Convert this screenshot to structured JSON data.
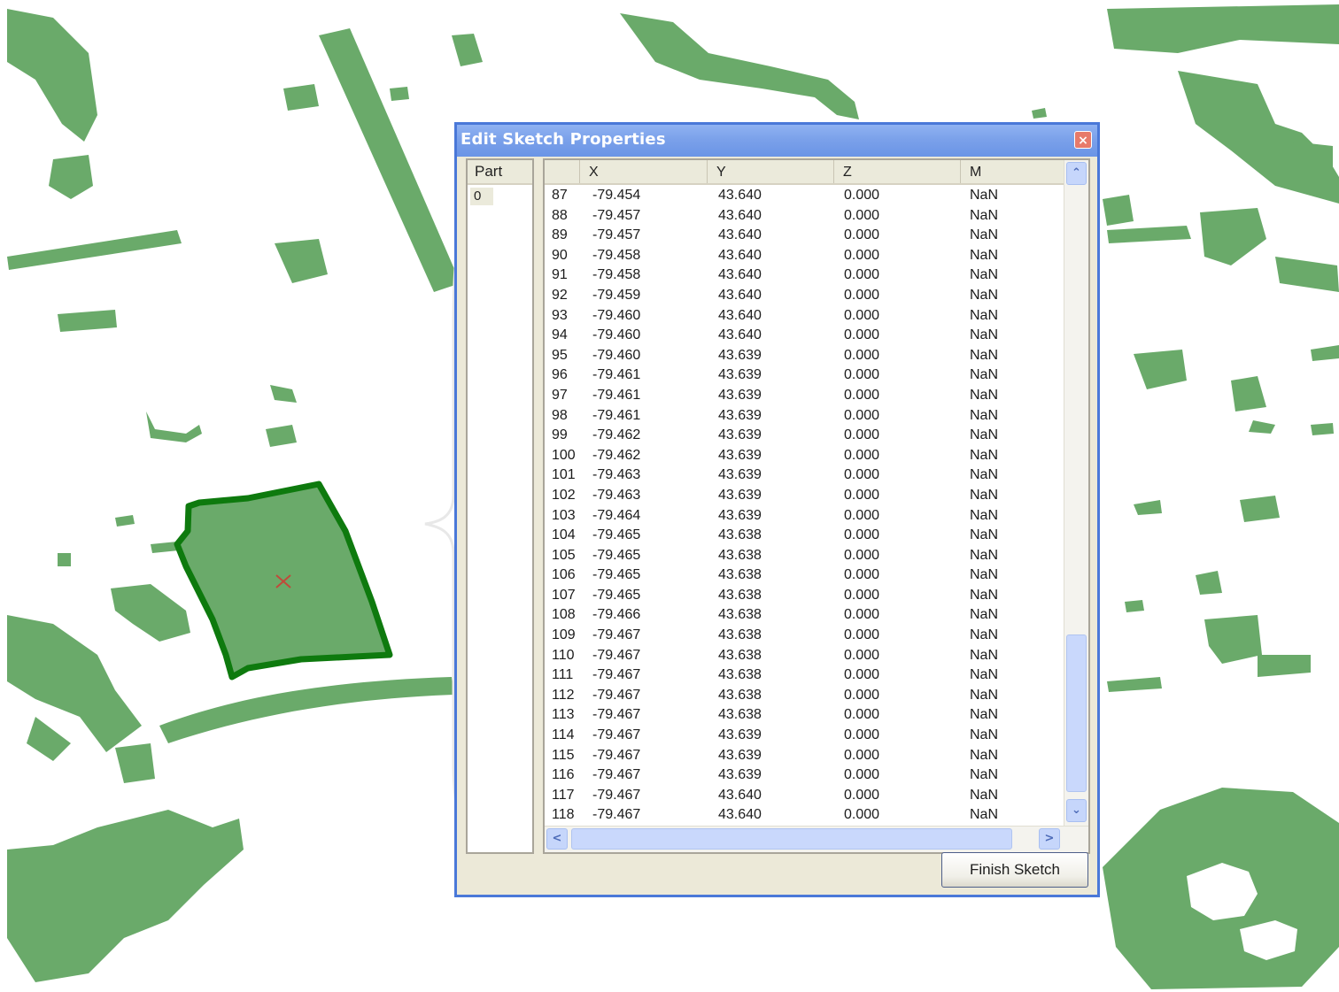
{
  "dialog": {
    "title": "Edit Sketch Properties",
    "close_label": "×",
    "finish_button": "Finish Sketch"
  },
  "parts": {
    "header": "Part",
    "items": [
      "0"
    ]
  },
  "grid": {
    "columns": [
      "",
      "X",
      "Y",
      "Z",
      "M"
    ],
    "rows": [
      [
        "87",
        "-79.454",
        "43.640",
        "0.000",
        "NaN"
      ],
      [
        "88",
        "-79.457",
        "43.640",
        "0.000",
        "NaN"
      ],
      [
        "89",
        "-79.457",
        "43.640",
        "0.000",
        "NaN"
      ],
      [
        "90",
        "-79.458",
        "43.640",
        "0.000",
        "NaN"
      ],
      [
        "91",
        "-79.458",
        "43.640",
        "0.000",
        "NaN"
      ],
      [
        "92",
        "-79.459",
        "43.640",
        "0.000",
        "NaN"
      ],
      [
        "93",
        "-79.460",
        "43.640",
        "0.000",
        "NaN"
      ],
      [
        "94",
        "-79.460",
        "43.640",
        "0.000",
        "NaN"
      ],
      [
        "95",
        "-79.460",
        "43.639",
        "0.000",
        "NaN"
      ],
      [
        "96",
        "-79.461",
        "43.639",
        "0.000",
        "NaN"
      ],
      [
        "97",
        "-79.461",
        "43.639",
        "0.000",
        "NaN"
      ],
      [
        "98",
        "-79.461",
        "43.639",
        "0.000",
        "NaN"
      ],
      [
        "99",
        "-79.462",
        "43.639",
        "0.000",
        "NaN"
      ],
      [
        "100",
        "-79.462",
        "43.639",
        "0.000",
        "NaN"
      ],
      [
        "101",
        "-79.463",
        "43.639",
        "0.000",
        "NaN"
      ],
      [
        "102",
        "-79.463",
        "43.639",
        "0.000",
        "NaN"
      ],
      [
        "103",
        "-79.464",
        "43.639",
        "0.000",
        "NaN"
      ],
      [
        "104",
        "-79.465",
        "43.638",
        "0.000",
        "NaN"
      ],
      [
        "105",
        "-79.465",
        "43.638",
        "0.000",
        "NaN"
      ],
      [
        "106",
        "-79.465",
        "43.638",
        "0.000",
        "NaN"
      ],
      [
        "107",
        "-79.465",
        "43.638",
        "0.000",
        "NaN"
      ],
      [
        "108",
        "-79.466",
        "43.638",
        "0.000",
        "NaN"
      ],
      [
        "109",
        "-79.467",
        "43.638",
        "0.000",
        "NaN"
      ],
      [
        "110",
        "-79.467",
        "43.638",
        "0.000",
        "NaN"
      ],
      [
        "111",
        "-79.467",
        "43.638",
        "0.000",
        "NaN"
      ],
      [
        "112",
        "-79.467",
        "43.638",
        "0.000",
        "NaN"
      ],
      [
        "113",
        "-79.467",
        "43.638",
        "0.000",
        "NaN"
      ],
      [
        "114",
        "-79.467",
        "43.639",
        "0.000",
        "NaN"
      ],
      [
        "115",
        "-79.467",
        "43.639",
        "0.000",
        "NaN"
      ],
      [
        "116",
        "-79.467",
        "43.639",
        "0.000",
        "NaN"
      ],
      [
        "117",
        "-79.467",
        "43.640",
        "0.000",
        "NaN"
      ],
      [
        "118",
        "-79.467",
        "43.640",
        "0.000",
        "NaN"
      ]
    ]
  },
  "colors": {
    "map_feature": "#6aaa6a",
    "selected_outline": "#0e7a0e",
    "title_bar": "#7ba1ea"
  }
}
